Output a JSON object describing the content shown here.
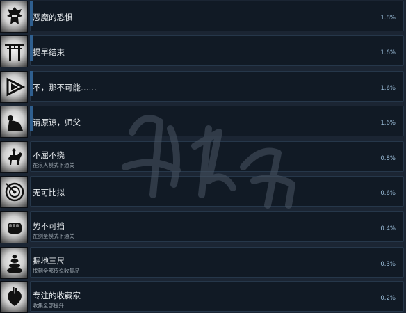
{
  "achievements": [
    {
      "title": "恶魔的恐惧",
      "subtitle": "",
      "percent": "1.8%",
      "icon": "samurai-helmet-icon",
      "unlocked": true
    },
    {
      "title": "提早结束",
      "subtitle": "",
      "percent": "1.6%",
      "icon": "torii-gate-icon",
      "unlocked": true
    },
    {
      "title": "不，那不可能……",
      "subtitle": "",
      "percent": "1.6%",
      "icon": "play-triangle-icon",
      "unlocked": true
    },
    {
      "title": "请原谅，师父",
      "subtitle": "",
      "percent": "1.6%",
      "icon": "bowing-figure-icon",
      "unlocked": true
    },
    {
      "title": "不屈不挠",
      "subtitle": "在浪人模式下通关",
      "percent": "0.8%",
      "icon": "horse-rider-icon",
      "unlocked": false
    },
    {
      "title": "无可比拟",
      "subtitle": "",
      "percent": "0.6%",
      "icon": "target-arrow-icon",
      "unlocked": false
    },
    {
      "title": "势不可挡",
      "subtitle": "在剑圣模式下通关",
      "percent": "0.4%",
      "icon": "fist-icon",
      "unlocked": false
    },
    {
      "title": "掘地三尺",
      "subtitle": "找到全部传说收集品",
      "percent": "0.3%",
      "icon": "stone-stack-icon",
      "unlocked": false
    },
    {
      "title": "专注的收藏家",
      "subtitle": "收集全部提升",
      "percent": "0.2%",
      "icon": "heart-organ-icon",
      "unlocked": false
    }
  ],
  "colors": {
    "background": "#1b2533",
    "row_background": "#111a25",
    "row_border": "#26374a",
    "accent": "#2f5f8f",
    "percent_text": "#9bbdd9"
  }
}
